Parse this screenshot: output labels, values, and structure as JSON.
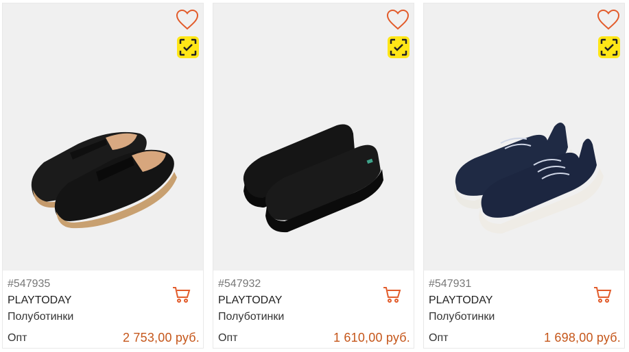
{
  "products": [
    {
      "sku": "#547935",
      "brand": "PLAYTODAY",
      "type": "Полуботинки",
      "opt_label": "Опт",
      "price": "2 753,00 руб.",
      "image": "black-suede-loafers-with-leather-strap",
      "favorite_icon": "heart-outline-icon",
      "scan_icon": "similar-search-icon",
      "cart_icon": "cart-icon"
    },
    {
      "sku": "#547932",
      "brand": "PLAYTODAY",
      "type": "Полуботинки",
      "opt_label": "Опт",
      "price": "1 610,00 руб.",
      "image": "black-slip-on-sneakers",
      "favorite_icon": "heart-outline-icon",
      "scan_icon": "similar-search-icon",
      "cart_icon": "cart-icon"
    },
    {
      "sku": "#547931",
      "brand": "PLAYTODAY",
      "type": "Полуботинки",
      "opt_label": "Опт",
      "price": "1 698,00 руб.",
      "image": "navy-knit-sneakers-with-white-sole",
      "favorite_icon": "heart-outline-icon",
      "scan_icon": "similar-search-icon",
      "cart_icon": "cart-icon"
    }
  ],
  "colors": {
    "accent": "#e25b2a",
    "price": "#c5561a",
    "scan_badge": "#ffe617",
    "photo_bg": "#f0f0f0"
  }
}
